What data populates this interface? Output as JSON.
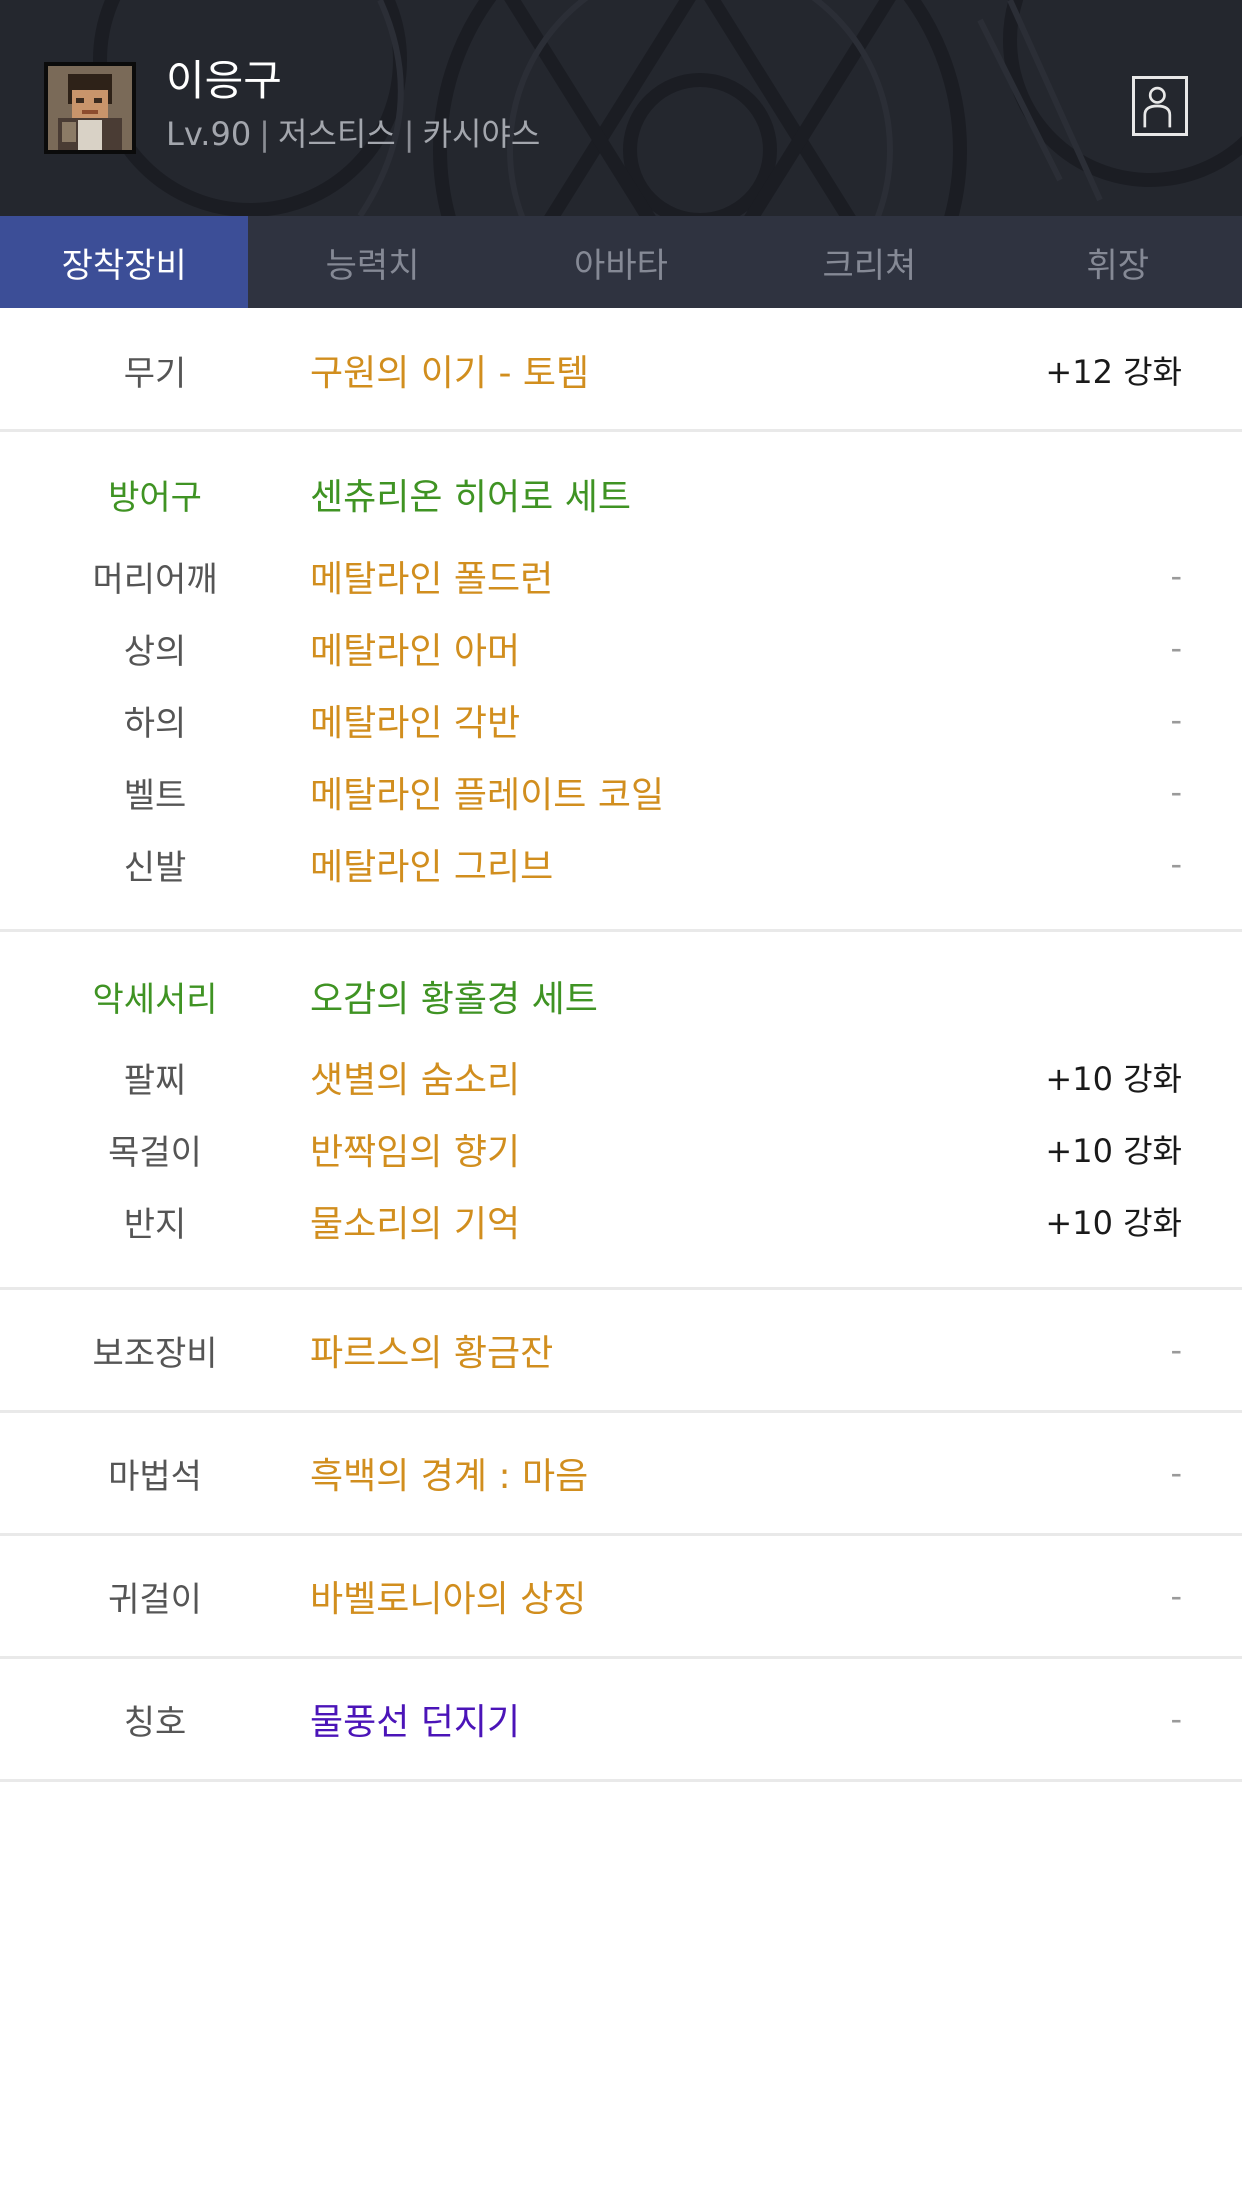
{
  "header": {
    "character_name": "이응구",
    "level": "Lv.90",
    "job": "저스티스",
    "server": "카시야스",
    "separator": "|"
  },
  "tabs": [
    {
      "label": "장착장비",
      "active": true
    },
    {
      "label": "능력치",
      "active": false
    },
    {
      "label": "아바타",
      "active": false
    },
    {
      "label": "크리쳐",
      "active": false
    },
    {
      "label": "휘장",
      "active": false
    }
  ],
  "colors": {
    "header_bg": "#24272e",
    "tab_bg": "#2f3340",
    "tab_active": "#3c4e97",
    "item_gold": "#d18e1e",
    "set_green": "#3f9323",
    "title_purple": "#4b14b8"
  },
  "weapon": {
    "slot": "무기",
    "item": "구원의 이기 - 토템",
    "upgrade": "+12 강화"
  },
  "armor": {
    "label": "방어구",
    "set_name": "센츄리온 히어로 세트",
    "items": [
      {
        "slot": "머리어깨",
        "item": "메탈라인 폴드런",
        "upgrade": "-"
      },
      {
        "slot": "상의",
        "item": "메탈라인 아머",
        "upgrade": "-"
      },
      {
        "slot": "하의",
        "item": "메탈라인 각반",
        "upgrade": "-"
      },
      {
        "slot": "벨트",
        "item": "메탈라인 플레이트 코일",
        "upgrade": "-"
      },
      {
        "slot": "신발",
        "item": "메탈라인 그리브",
        "upgrade": "-"
      }
    ]
  },
  "accessory": {
    "label": "악세서리",
    "set_name": "오감의 황홀경 세트",
    "items": [
      {
        "slot": "팔찌",
        "item": "샛별의 숨소리",
        "upgrade": "+10 강화"
      },
      {
        "slot": "목걸이",
        "item": "반짝임의 향기",
        "upgrade": "+10 강화"
      },
      {
        "slot": "반지",
        "item": "물소리의 기억",
        "upgrade": "+10 강화"
      }
    ]
  },
  "sub_equipment": {
    "slot": "보조장비",
    "item": "파르스의 황금잔",
    "upgrade": "-"
  },
  "magic_stone": {
    "slot": "마법석",
    "item": "흑백의 경계 : 마음",
    "upgrade": "-"
  },
  "earring": {
    "slot": "귀걸이",
    "item": "바벨로니아의 상징",
    "upgrade": "-"
  },
  "title": {
    "slot": "칭호",
    "item": "물풍선 던지기",
    "upgrade": "-"
  }
}
